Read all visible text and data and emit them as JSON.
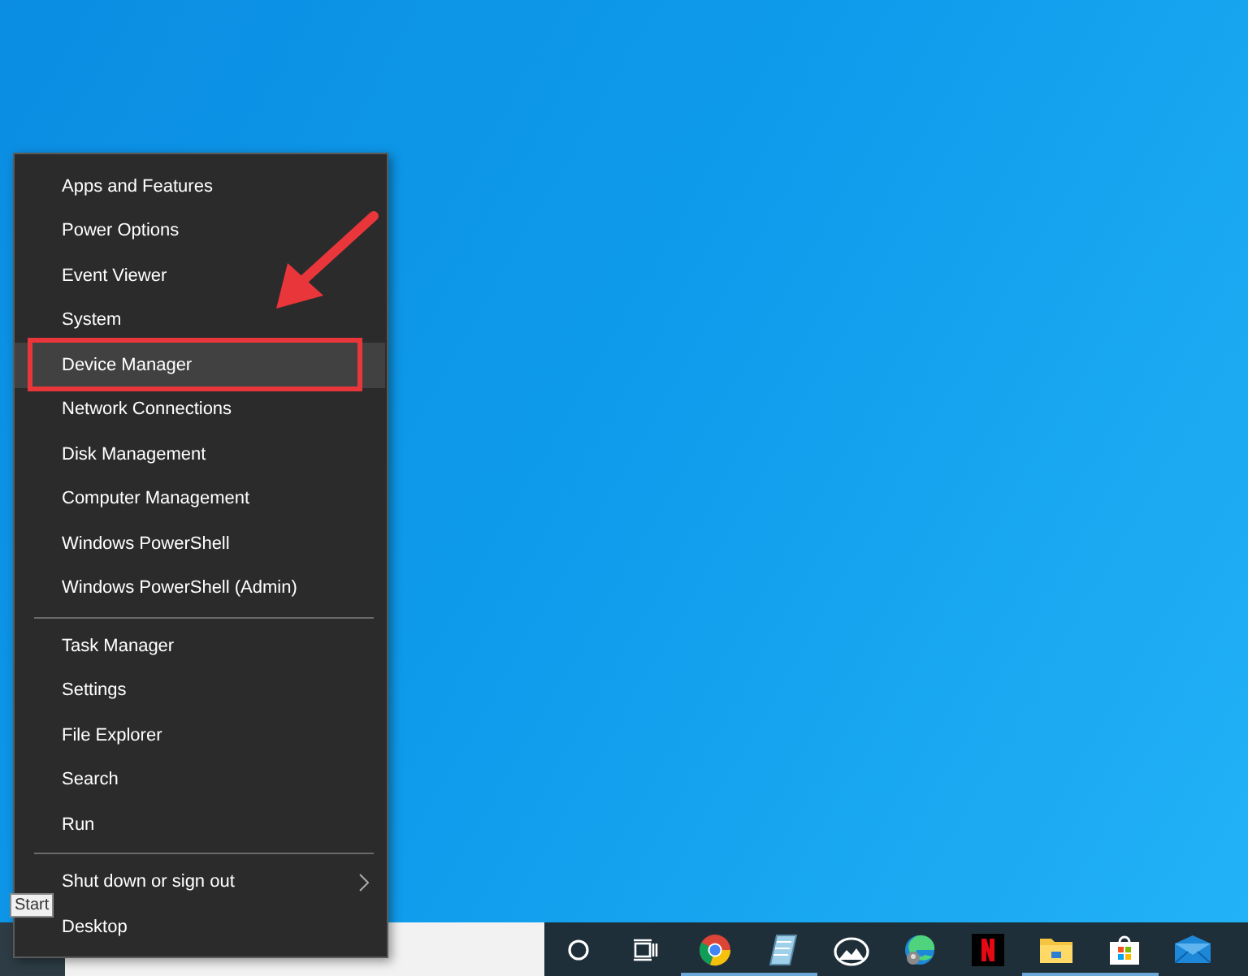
{
  "menu": {
    "groups": [
      {
        "items": [
          {
            "label": "Apps and Features",
            "selected": false,
            "kind": "item"
          },
          {
            "label": "Power Options",
            "selected": false,
            "kind": "item"
          },
          {
            "label": "Event Viewer",
            "selected": false,
            "kind": "item"
          },
          {
            "label": "System",
            "selected": false,
            "kind": "item"
          },
          {
            "label": "Device Manager",
            "selected": true,
            "kind": "item"
          },
          {
            "label": "Network Connections",
            "selected": false,
            "kind": "item"
          },
          {
            "label": "Disk Management",
            "selected": false,
            "kind": "item"
          },
          {
            "label": "Computer Management",
            "selected": false,
            "kind": "item"
          },
          {
            "label": "Windows PowerShell",
            "selected": false,
            "kind": "item"
          },
          {
            "label": "Windows PowerShell (Admin)",
            "selected": false,
            "kind": "item"
          }
        ]
      },
      {
        "items": [
          {
            "label": "Task Manager",
            "selected": false,
            "kind": "item"
          },
          {
            "label": "Settings",
            "selected": false,
            "kind": "item"
          },
          {
            "label": "File Explorer",
            "selected": false,
            "kind": "item"
          },
          {
            "label": "Search",
            "selected": false,
            "kind": "item"
          },
          {
            "label": "Run",
            "selected": false,
            "kind": "item"
          }
        ]
      },
      {
        "items": [
          {
            "label": "Shut down or sign out",
            "selected": false,
            "kind": "submenu"
          },
          {
            "label": "Desktop",
            "selected": false,
            "kind": "item"
          }
        ]
      }
    ]
  },
  "tooltip": {
    "text": "Start"
  },
  "taskbar": {
    "apps": [
      {
        "kind": "cortana",
        "running": false
      },
      {
        "kind": "taskview",
        "running": false
      },
      {
        "kind": "chrome",
        "running": true
      },
      {
        "kind": "notepad",
        "running": true
      },
      {
        "kind": "photos",
        "running": false
      },
      {
        "kind": "edge",
        "running": false
      },
      {
        "kind": "netflix",
        "running": false
      },
      {
        "kind": "folder",
        "running": true
      },
      {
        "kind": "store",
        "running": true
      },
      {
        "kind": "mail",
        "running": false
      }
    ]
  }
}
